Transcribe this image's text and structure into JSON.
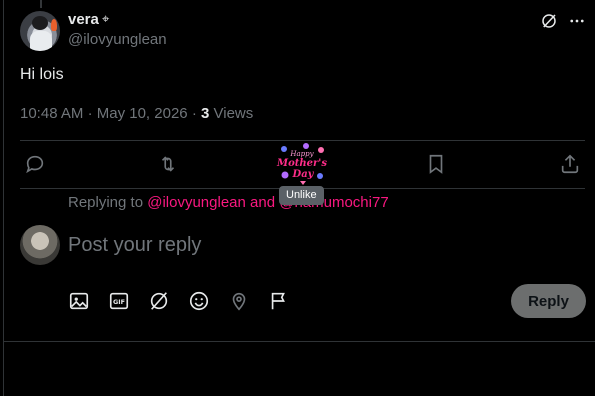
{
  "author": {
    "name": "vera",
    "name_icon": "⌖",
    "handle": "@ilovyunglean"
  },
  "tweet": {
    "text": "Hi lois",
    "time": "10:48 AM",
    "sep1": "·",
    "date": "May 10, 2026",
    "sep2": "·",
    "views_count": "3",
    "views_label": "Views"
  },
  "sticker": {
    "text_line1": "Happy",
    "text_line2": "Mother's",
    "text_line3": "Day",
    "tooltip": "Unlike"
  },
  "reply": {
    "replying_to_label": "Replying to",
    "mention1": "@ilovyunglean",
    "and": "and",
    "mention2": "@hamumochi77",
    "placeholder": "Post your reply",
    "button_label": "Reply"
  },
  "colors": {
    "accent_pink": "#f91880",
    "muted": "#71767b",
    "text": "#e7e9ea",
    "divider": "#2f3336"
  },
  "icons": {
    "top": [
      "grok-icon",
      "more-icon"
    ],
    "actions": [
      "reply-icon",
      "retweet-icon",
      "like-sticker",
      "bookmark-icon",
      "share-icon"
    ],
    "composer_tools": [
      "image-icon",
      "gif-icon",
      "grok-icon",
      "emoji-icon",
      "location-icon",
      "flag-icon"
    ]
  }
}
